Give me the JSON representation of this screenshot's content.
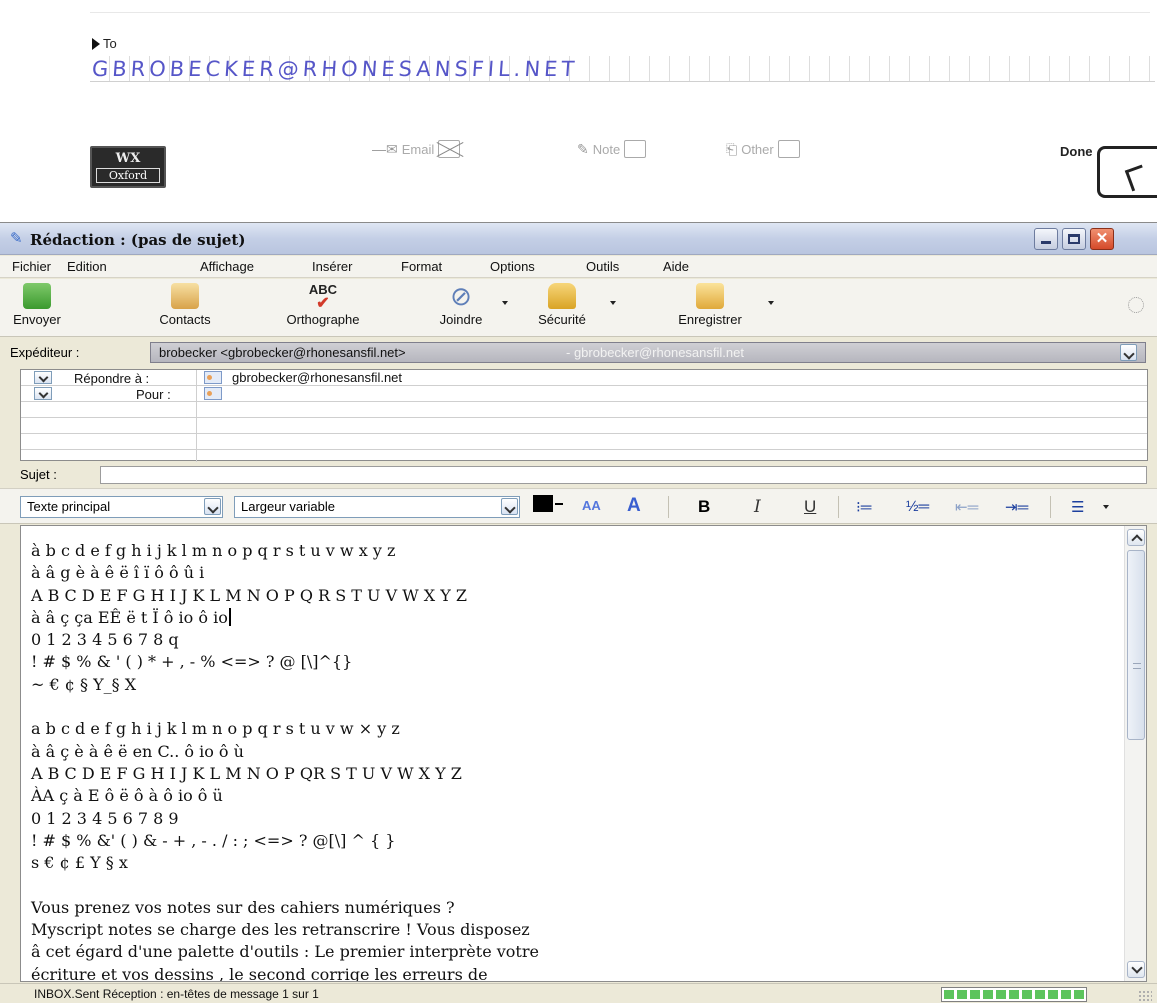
{
  "form": {
    "to_label": "To",
    "handwriting": "GBROBECKER@RHONESANSFIL.NET",
    "logo_top": "WX",
    "logo_bottom": "Oxford",
    "options": [
      {
        "label": "Email",
        "checked": true,
        "icon": "envelope-icon"
      },
      {
        "label": "Note",
        "checked": false,
        "icon": "note-icon"
      },
      {
        "label": "Other",
        "checked": false,
        "icon": "other-icon"
      }
    ],
    "done_label": "Done"
  },
  "window": {
    "title": "Rédaction : (pas de sujet)",
    "menu": [
      "Fichier",
      "Edition",
      "Affichage",
      "Insérer",
      "Format",
      "Options",
      "Outils",
      "Aide"
    ],
    "toolbar": [
      {
        "label": "Envoyer",
        "icon": "send-icon"
      },
      {
        "label": "Contacts",
        "icon": "contacts-icon"
      },
      {
        "label": "Orthographe",
        "icon": "spellcheck-icon"
      },
      {
        "label": "Joindre",
        "icon": "paperclip-icon"
      },
      {
        "label": "Sécurité",
        "icon": "padlock-icon"
      },
      {
        "label": "Enregistrer",
        "icon": "folder-icon"
      }
    ],
    "sender_label": "Expéditeur :",
    "sender_value": "brobecker <gbrobecker@rhonesansfil.net>",
    "sender_extra": "- gbrobecker@rhonesansfil.net",
    "reply_label": "Répondre à :",
    "reply_value": "gbrobecker@rhonesansfil.net",
    "to_label": "Pour :",
    "subject_label": "Sujet :",
    "subject_value": "",
    "format": {
      "paragraph": "Texte principal",
      "font": "Largeur variable",
      "text_color": "#000000",
      "tools": [
        "AA",
        "A",
        "B",
        "I",
        "U",
        "bullet-list-icon",
        "numbered-list-icon",
        "outdent-icon",
        "indent-icon",
        "align-icon"
      ]
    },
    "body": [
      "à b c d e f g h i j k l m n o p q r s t u v w x y z",
      "à â g è à ê ë î ï ô ô û i",
      "A B C D E F G H I J K L M N O P Q R S T U V W X Y Z",
      "à â ç ça EÊ ë t Ï ô io ô io",
      "0 1 2 3 4 5 6 7 8 q",
      "! # $ % & ' ( ) * + , - % <=> ? @ [\\]^{}",
      "~ € ¢ § Y_§ X",
      "",
      "a b c d e f g h i j k l m n o p q r s t u v w × y z",
      "à â ç è à ê ë en C.. ô io ô ù",
      "A B C D E F G H I J K L M N O P QR S T U V W X Y Z",
      "ÀA ç à E ô ë ô à ô io ô ü",
      "0 1 2 3 4 5 6 7 8 9",
      "! # $ % &' ( ) & - + , - . / : ; <=> ? @[\\] ^ { }",
      "s € ¢ £ Y § x",
      "",
      "Vous prenez vos notes sur des cahiers numériques ?",
      "Myscript notes se charge des les retranscrire ! Vous disposez",
      "â cet égard d'une palette d'outils : Le premier interprète votre",
      "écriture et vos dessins , le second corrige les erreurs de"
    ],
    "status": "INBOX.Sent Réception : en-têtes de message 1 sur 1",
    "progress": 1.0
  }
}
